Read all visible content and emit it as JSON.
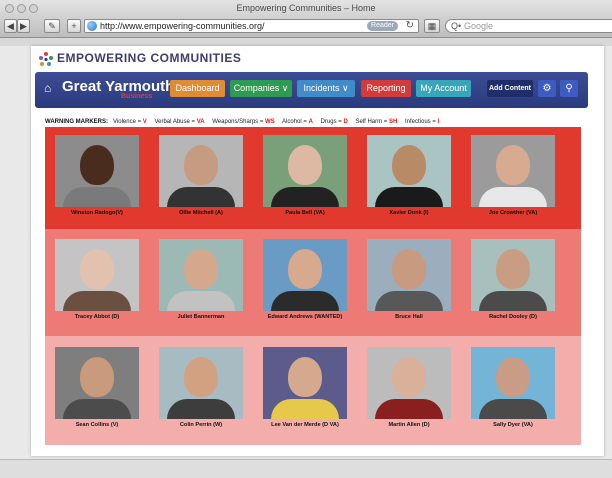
{
  "window_title": "Empowering Communities – Home",
  "address_bar": {
    "url": "http://www.empowering-communities.org/",
    "reader_label": "Reader",
    "reload_glyph": "↻"
  },
  "search_bar": {
    "placeholder": "Google",
    "prefix": "Q•"
  },
  "site": {
    "name": "EMPOWERING COMMUNITIES"
  },
  "navbar": {
    "town": "Great Yarmouth",
    "town_sub": "Business",
    "dashboard_label": "Dashboard",
    "companies_label": "Companies ∨",
    "incidents_label": "Incidents ∨",
    "reporting_label": "Reporting",
    "account_label": "My Account",
    "add_content_label": "Add Content",
    "tools_icon": "wrench-icon",
    "search_icon": "search-icon"
  },
  "warning_markers": {
    "heading": "WARNING MARKERS:",
    "items": [
      {
        "label": "Violence",
        "code": "V"
      },
      {
        "label": "Verbal Abuse",
        "code": "VA"
      },
      {
        "label": "Weapons/Sharps",
        "code": "WS"
      },
      {
        "label": "Alcohol",
        "code": "A"
      },
      {
        "label": "Drugs",
        "code": "D"
      },
      {
        "label": "Self Harm",
        "code": "SH"
      },
      {
        "label": "Infectious",
        "code": "I"
      }
    ]
  },
  "colors": {
    "row1": "#e2392f",
    "row2": "#ee7a76",
    "row3": "#f3adab",
    "navbar": "#2f3f86"
  },
  "people": [
    {
      "name": "Winston Radogo(V)",
      "bg": "#8c8c8c",
      "skin": "#4a2c1e",
      "shirt": "#7a7a7a"
    },
    {
      "name": "Ollie Mitchell (A)",
      "bg": "#b6b6b6",
      "skin": "#c59c82",
      "shirt": "#333333"
    },
    {
      "name": "Paula Bell (VA)",
      "bg": "#7aa07a",
      "skin": "#ddb8a2",
      "shirt": "#222222"
    },
    {
      "name": "Xavier Donk (I)",
      "bg": "#a9c4c2",
      "skin": "#b98a66",
      "shirt": "#1a1a1a"
    },
    {
      "name": "Joe Crowther (VA)",
      "bg": "#9b9b9b",
      "skin": "#d7ab90",
      "shirt": "#e8e8e8"
    },
    {
      "name": "Tracey Abbot  (D)",
      "bg": "#c4c4c4",
      "skin": "#e2c1ae",
      "shirt": "#6b5042"
    },
    {
      "name": "Juliet  Bannerman",
      "bg": "#9cb9b6",
      "skin": "#d3a88d",
      "shirt": "#c2c2c2"
    },
    {
      "name": "Edward Andrews (WANTED)",
      "bg": "#6a9bc4",
      "skin": "#d7a98e",
      "shirt": "#2b2b2b"
    },
    {
      "name": "Bruce Hall",
      "bg": "#9aaebd",
      "skin": "#c89a80",
      "shirt": "#585858"
    },
    {
      "name": "Rachel Dooley (D)",
      "bg": "#a7c0bd",
      "skin": "#c99d84",
      "shirt": "#4b4b4b"
    },
    {
      "name": "Sean Collins (V)",
      "bg": "#7e7e7e",
      "skin": "#c99a7b",
      "shirt": "#4c4c4c"
    },
    {
      "name": "Colin Perrin (W)",
      "bg": "#a7bcc2",
      "skin": "#d2a182",
      "shirt": "#3d3d3d"
    },
    {
      "name": "Lee Van der Merde (D VA)",
      "bg": "#5c5c8c",
      "skin": "#d4a98d",
      "shirt": "#e6c84a"
    },
    {
      "name": "Martin Allen (D)",
      "bg": "#bcbcbc",
      "skin": "#d9b09a",
      "shirt": "#8a1f1f"
    },
    {
      "name": "Sally Dyer (VA)",
      "bg": "#74b4d6",
      "skin": "#c89c85",
      "shirt": "#4a4a4a"
    }
  ]
}
